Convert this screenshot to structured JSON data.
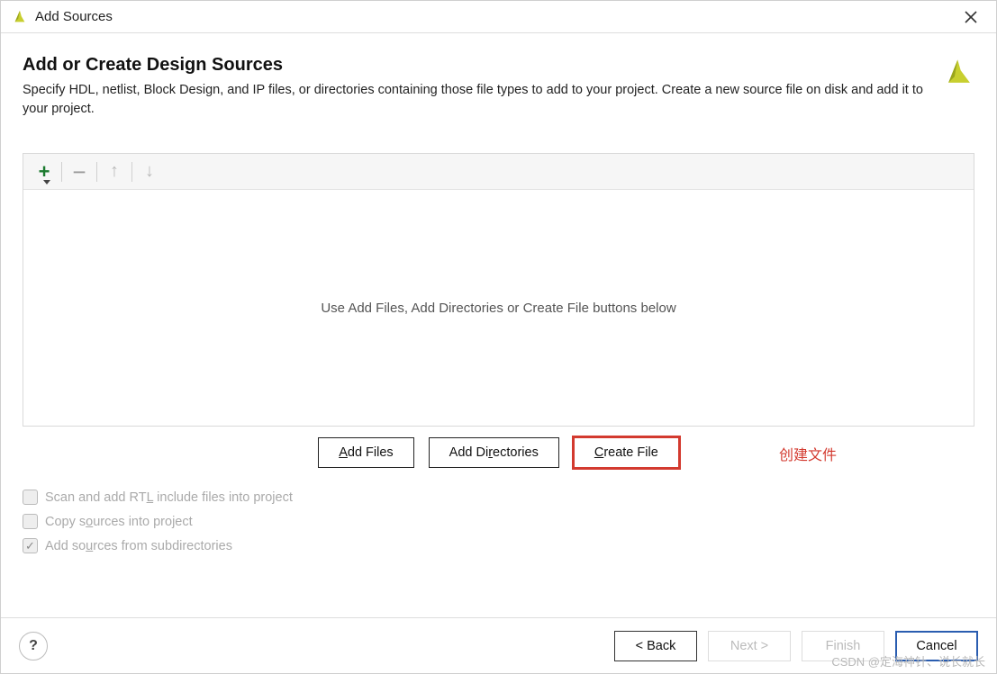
{
  "titlebar": {
    "title": "Add Sources"
  },
  "header": {
    "heading": "Add or Create Design Sources",
    "subheading": "Specify HDL, netlist, Block Design, and IP files, or directories containing those file types to add to your project. Create a new source file on disk and add it to your project."
  },
  "list": {
    "placeholder": "Use Add Files, Add Directories or Create File buttons below"
  },
  "actions": {
    "add_files_u": "A",
    "add_files_rest": "dd Files",
    "add_dirs_pre": "Add Di",
    "add_dirs_u": "r",
    "add_dirs_rest": "ectories",
    "create_file_u": "C",
    "create_file_rest": "reate File",
    "annotation": "创建文件"
  },
  "checks": {
    "c1_pre": "Scan and add RT",
    "c1_u": "L",
    "c1_rest": " include files into project",
    "c1_checked": false,
    "c2_pre": "Copy s",
    "c2_u": "o",
    "c2_rest": "urces into project",
    "c2_checked": false,
    "c3_pre": "Add so",
    "c3_u": "u",
    "c3_rest": "rces from subdirectories",
    "c3_checked": true
  },
  "footer": {
    "help": "?",
    "back_pre": "< ",
    "back_u": "B",
    "back_rest": "ack",
    "next_u": "N",
    "next_rest": "ext >",
    "finish_u": "F",
    "finish_rest": "inish",
    "cancel": "Cancel"
  },
  "watermark": "CSDN @定海神针、说长就长",
  "colors": {
    "accent_red": "#d33a2f",
    "accent_blue": "#2a5db0",
    "accent_green": "#1b7a2e",
    "brand": "#c8cf2f"
  }
}
